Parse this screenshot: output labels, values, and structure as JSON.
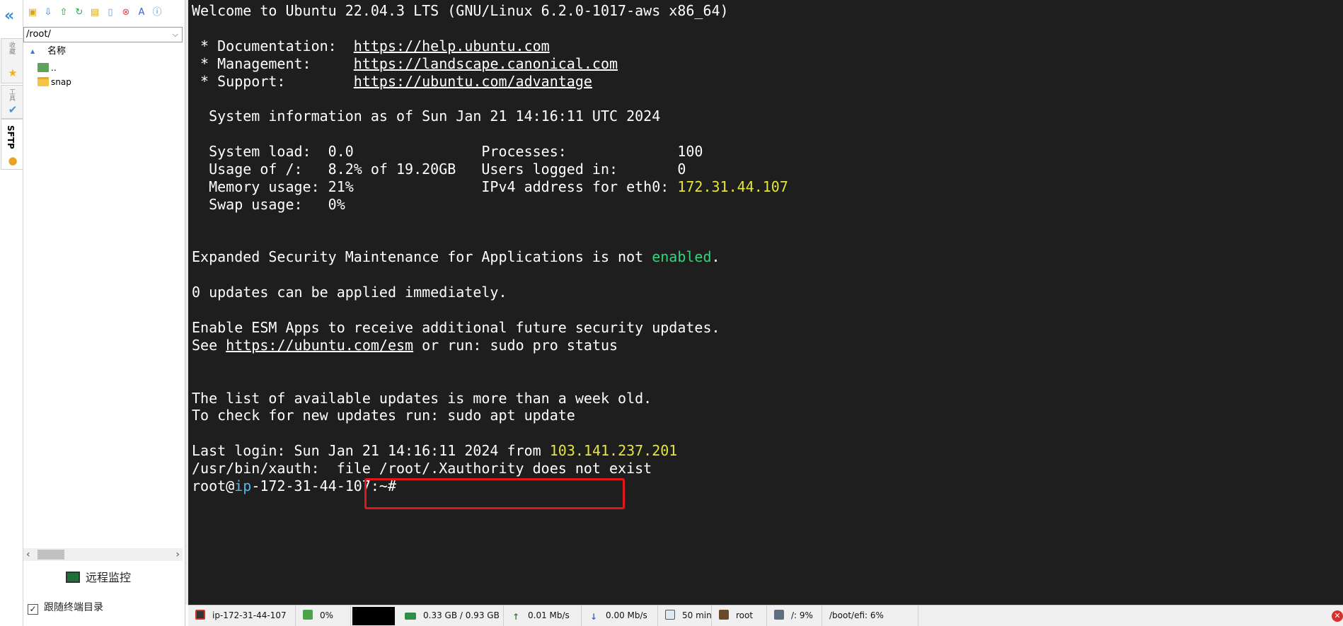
{
  "side_tabs": {
    "favorites_label": "收藏",
    "tools_label": "工具",
    "sftp_label": "SFTP"
  },
  "sftp": {
    "toolbar_icons": [
      "upload-folder-icon",
      "download-icon",
      "upload-icon",
      "refresh-icon",
      "new-folder-icon",
      "new-file-icon",
      "delete-icon",
      "rename-icon",
      "info-icon"
    ],
    "path": "/root/",
    "column_name": "名称",
    "files": [
      {
        "name": "..",
        "type": "parent"
      },
      {
        "name": "snap",
        "type": "folder"
      }
    ],
    "remote_monitor_label": "远程监控",
    "follow_dir_label": "跟随终端目录",
    "follow_dir_checked": true
  },
  "terminal": {
    "lines": [
      [
        {
          "t": "Welcome to Ubuntu 22.04.3 LTS (GNU/Linux 6.2.0-1017-aws x86_64)"
        }
      ],
      [
        {
          "t": ""
        }
      ],
      [
        {
          "t": " * Documentation:  "
        },
        {
          "t": "https://help.ubuntu.com",
          "c": "u"
        }
      ],
      [
        {
          "t": " * Management:     "
        },
        {
          "t": "https://landscape.canonical.com",
          "c": "u"
        }
      ],
      [
        {
          "t": " * Support:        "
        },
        {
          "t": "https://ubuntu.com/advantage",
          "c": "u"
        }
      ],
      [
        {
          "t": ""
        }
      ],
      [
        {
          "t": "  System information as of Sun Jan 21 14:16:11 UTC 2024"
        }
      ],
      [
        {
          "t": ""
        }
      ],
      [
        {
          "t": "  System load:  0.0               Processes:             100"
        }
      ],
      [
        {
          "t": "  Usage of /:   8.2% of 19.20GB   Users logged in:       0"
        }
      ],
      [
        {
          "t": "  Memory usage: 21%               IPv4 address for eth0: "
        },
        {
          "t": "172.31.44.107",
          "c": "yellow"
        }
      ],
      [
        {
          "t": "  Swap usage:   0%"
        }
      ],
      [
        {
          "t": ""
        }
      ],
      [
        {
          "t": ""
        }
      ],
      [
        {
          "t": "Expanded Security Maintenance for Applications is not "
        },
        {
          "t": "enabled",
          "c": "green"
        },
        {
          "t": "."
        }
      ],
      [
        {
          "t": ""
        }
      ],
      [
        {
          "t": "0 updates can be applied immediately."
        }
      ],
      [
        {
          "t": ""
        }
      ],
      [
        {
          "t": "Enable ESM Apps to receive additional future security updates."
        }
      ],
      [
        {
          "t": "See "
        },
        {
          "t": "https://ubuntu.com/esm",
          "c": "u"
        },
        {
          "t": " or run: sudo pro status"
        }
      ],
      [
        {
          "t": ""
        }
      ],
      [
        {
          "t": ""
        }
      ],
      [
        {
          "t": "The list of available updates is more than a week old."
        }
      ],
      [
        {
          "t": "To check for new updates run: sudo apt update"
        }
      ],
      [
        {
          "t": ""
        }
      ],
      [
        {
          "t": "Last login: Sun Jan 21 14:16:11 2024 from "
        },
        {
          "t": "103.141.237.201",
          "c": "yellow"
        }
      ],
      [
        {
          "t": "/usr/bin/xauth:  file /root/.Xauthority does not exist"
        }
      ],
      [
        {
          "t": "root@"
        },
        {
          "t": "ip",
          "c": "cyan"
        },
        {
          "t": "-172-31-44-107:~#"
        }
      ]
    ],
    "highlight_color": "#e0161b"
  },
  "statusbar": {
    "host": "ip-172-31-44-107",
    "cpu": "0%",
    "memory": "0.33 GB / 0.93 GB",
    "upload": "0.01 Mb/s",
    "download": "0.00 Mb/s",
    "ping": "50 min",
    "user": "root",
    "disk_root": "/: 9%",
    "disk_boot": "/boot/efi: 6%"
  }
}
